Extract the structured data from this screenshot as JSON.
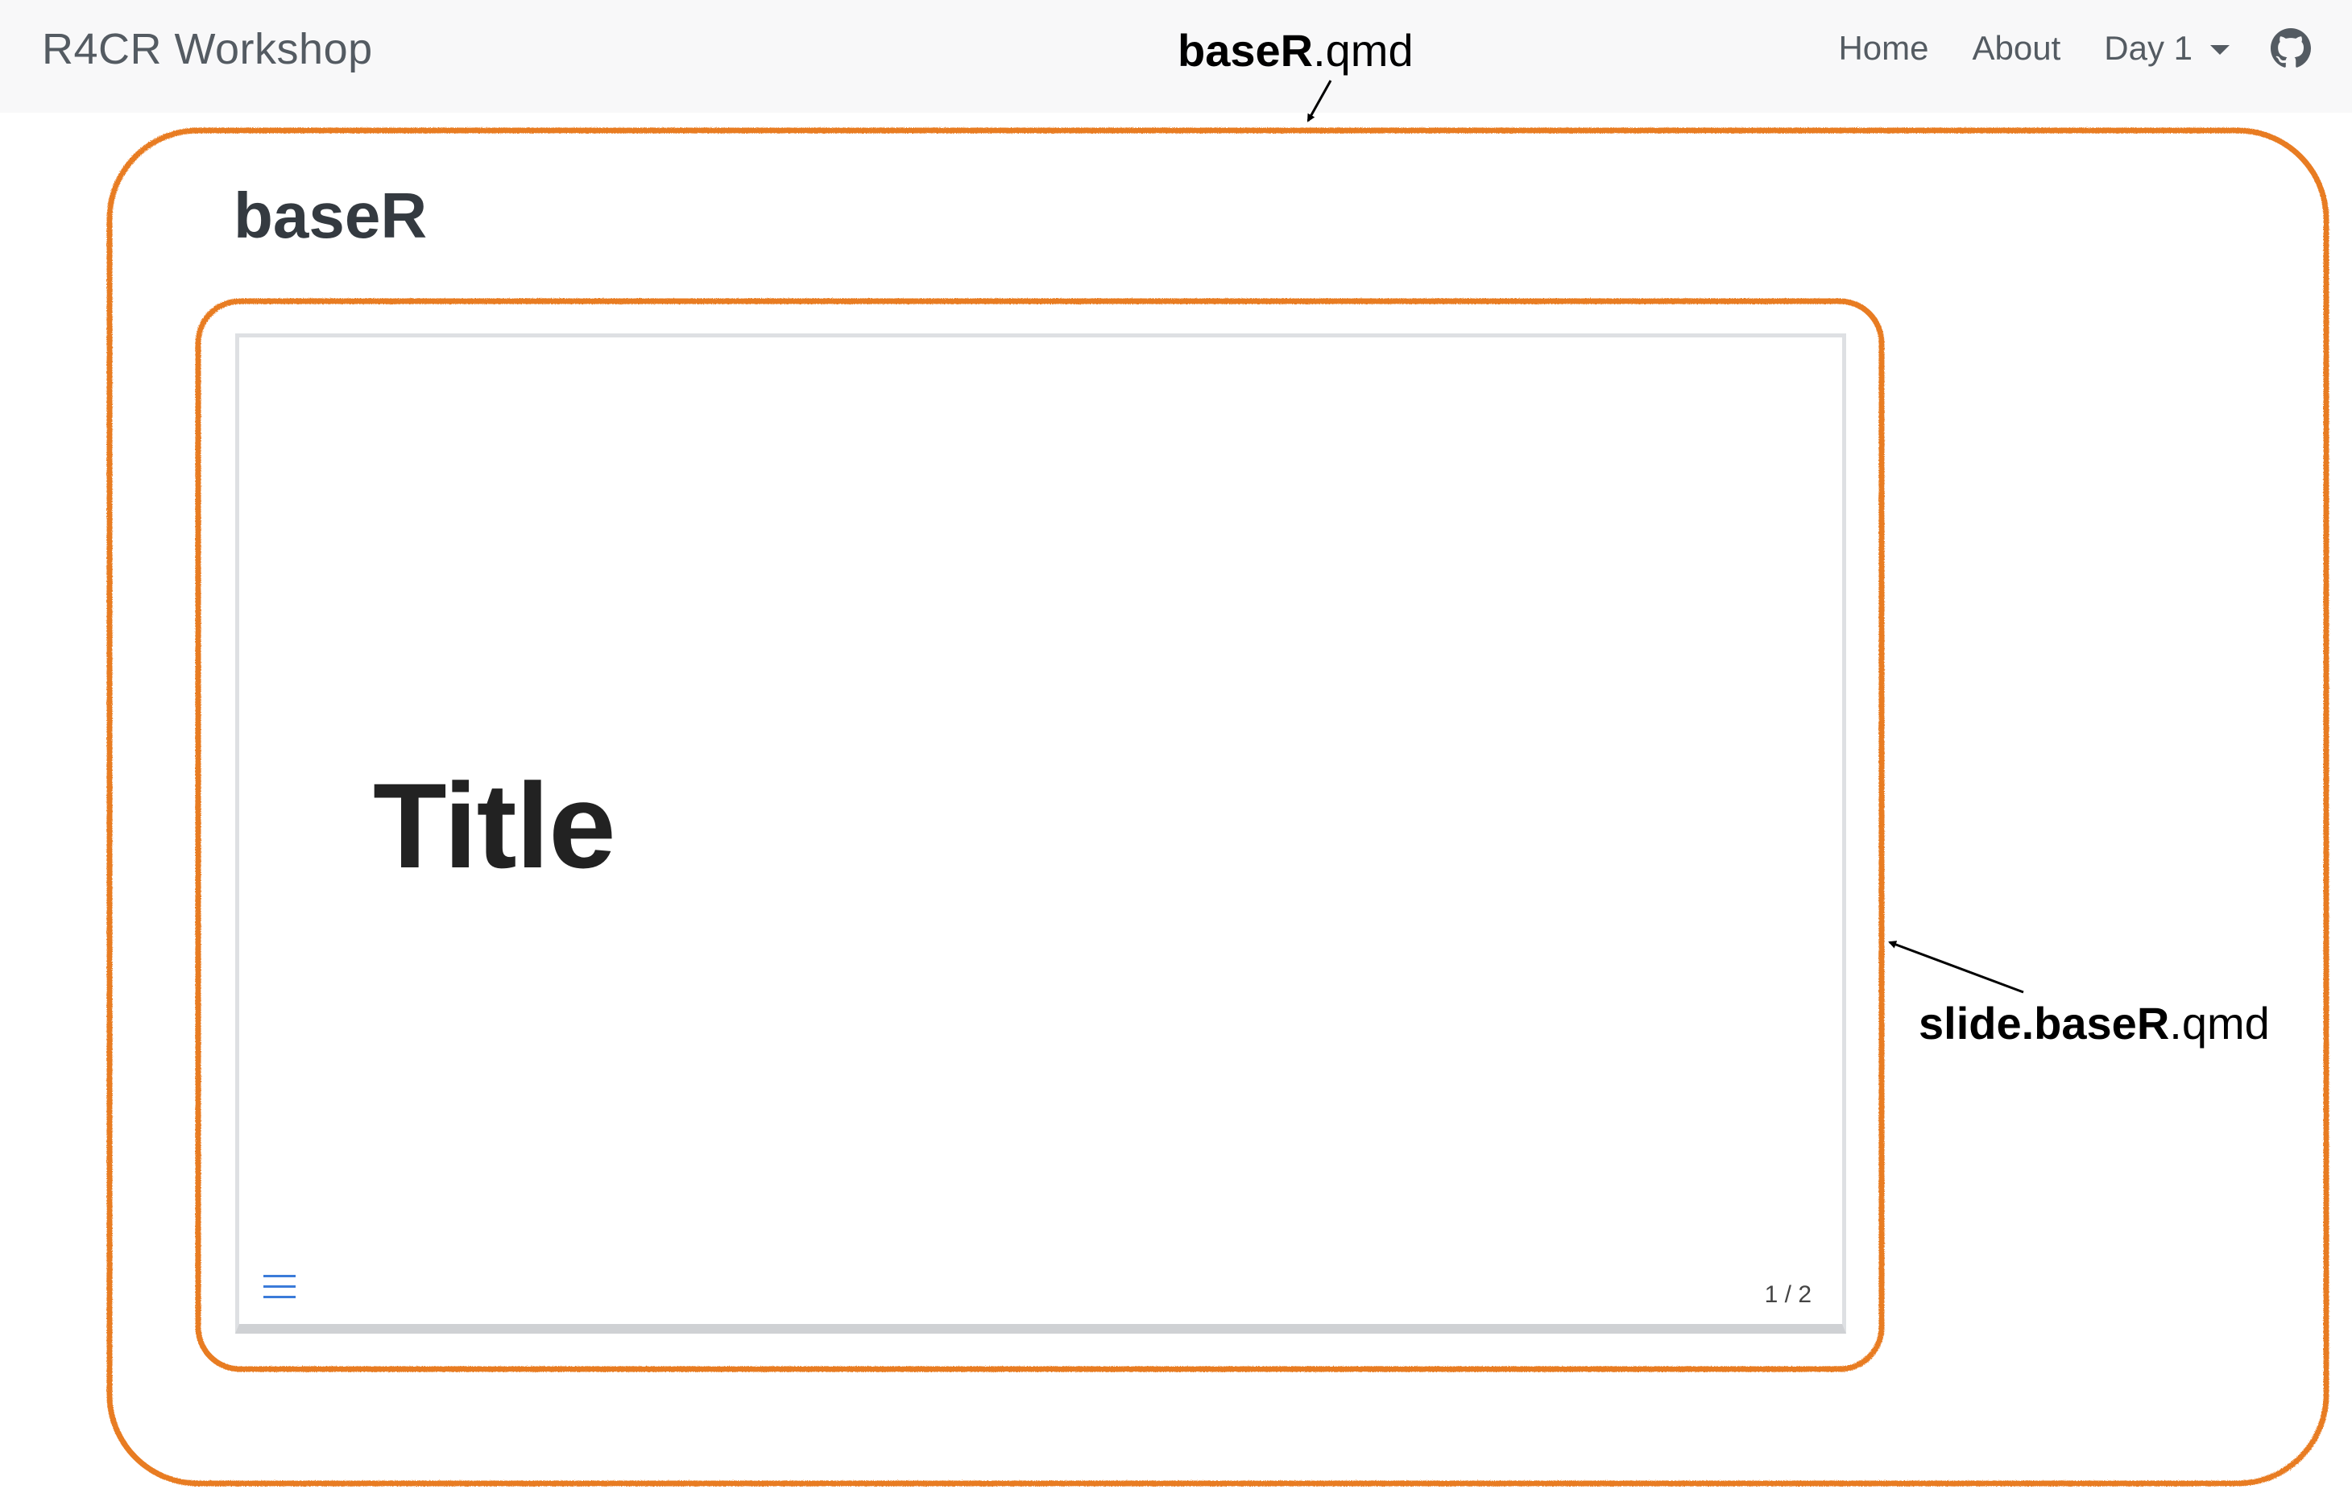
{
  "navbar": {
    "brand": "R4CR Workshop",
    "links": [
      {
        "label": "Home"
      },
      {
        "label": "About"
      },
      {
        "label": "Day 1",
        "dropdown": true
      }
    ],
    "github_icon": "github-icon"
  },
  "annotations": {
    "page_file_bold": "baseR",
    "page_file_ext": ".qmd",
    "slide_file_bold": "slide.baseR",
    "slide_file_ext": ".qmd",
    "outline_color": "#e87b22"
  },
  "page": {
    "title": "baseR"
  },
  "slide": {
    "title": "Title",
    "menu_icon": "hamburger-menu-icon",
    "slide_number": "1 / 2",
    "menu_color": "#3b7bd9"
  }
}
